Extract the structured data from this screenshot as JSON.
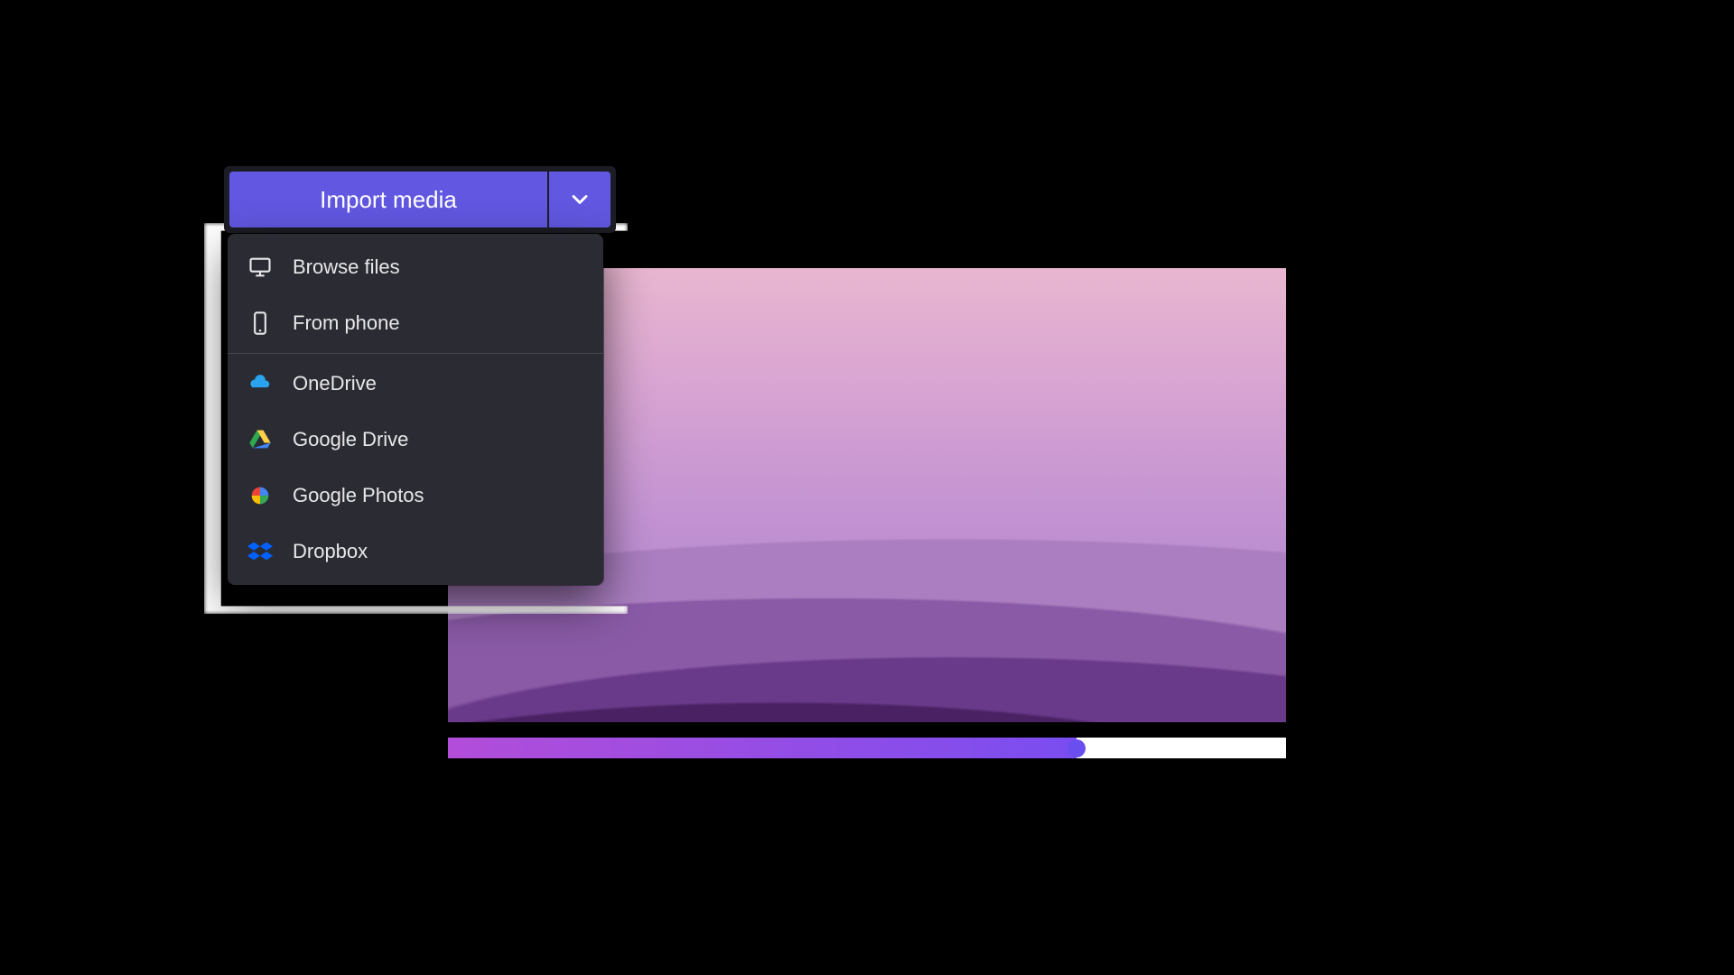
{
  "import_button": {
    "label": "Import media"
  },
  "menu": {
    "items": [
      {
        "label": "Browse files",
        "icon": "monitor"
      },
      {
        "label": "From phone",
        "icon": "phone"
      },
      {
        "label": "OneDrive",
        "icon": "onedrive"
      },
      {
        "label": "Google Drive",
        "icon": "google-drive"
      },
      {
        "label": "Google Photos",
        "icon": "google-photos"
      },
      {
        "label": "Dropbox",
        "icon": "dropbox"
      }
    ]
  },
  "timeline": {
    "progress_percent": 75
  },
  "colors": {
    "accent": "#6157e0",
    "menu_bg": "#2b2b33"
  }
}
